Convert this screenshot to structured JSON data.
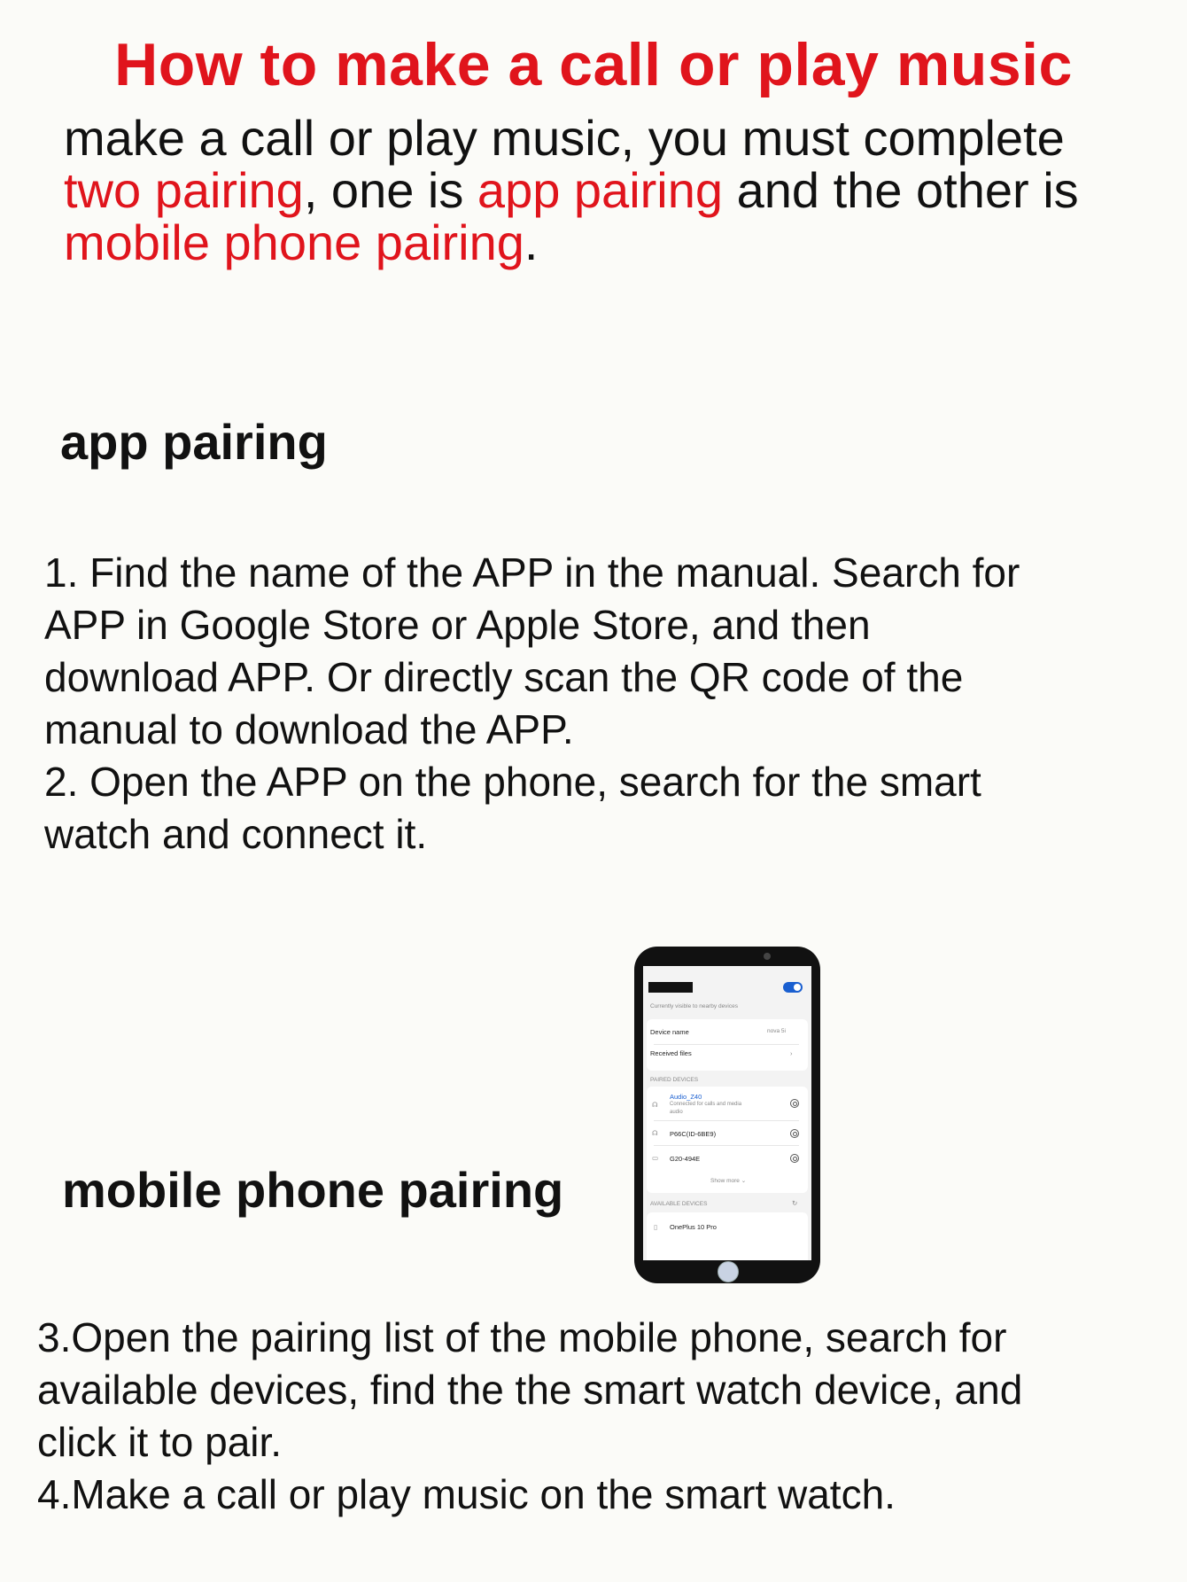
{
  "title": "How to make a call or play music",
  "intro": {
    "p1": "make a call or play music, you must complete",
    "p2_red1": "two pairing",
    "p2_mid": ", one is ",
    "p2_red2": "app pairing",
    "p2_end": " and the other is",
    "p3_red": "mobile phone pairing",
    "p3_end": "."
  },
  "app_pairing": {
    "heading": "app pairing",
    "lines": [
      "1. Find the name of the APP in the manual. Search for",
      "APP in Google Store or Apple Store, and then",
      "download APP. Or directly scan the QR code of the",
      "manual to download the APP.",
      "2. Open the APP on the phone, search for the smart",
      "watch and connect it."
    ]
  },
  "mobile_pairing": {
    "heading": "mobile phone pairing",
    "lines": [
      "3.Open the pairing list of the mobile phone, search for",
      "available devices, find the the smart watch device, and",
      "click it to pair.",
      "4.Make a call or play music on the smart watch."
    ]
  },
  "phone_screen": {
    "visible_text": "Currently visible to nearby devices",
    "device_name_label": "Device name",
    "device_name_value": "nova 5i",
    "received_files_label": "Received files",
    "paired_header": "PAIRED DEVICES",
    "paired": [
      {
        "name": "Audio_Z40",
        "sub1": "Connected for calls and media",
        "sub2": "audio"
      },
      {
        "name": "P66C(ID-6BE9)"
      },
      {
        "name": "G20-494E"
      }
    ],
    "show_more": "Show more",
    "available_header": "AVAILABLE DEVICES",
    "available_first": "OnePlus 10 Pro",
    "accent_color": "#1a5fd0"
  },
  "colors": {
    "title_red": "#e0141c",
    "text": "#111111"
  }
}
